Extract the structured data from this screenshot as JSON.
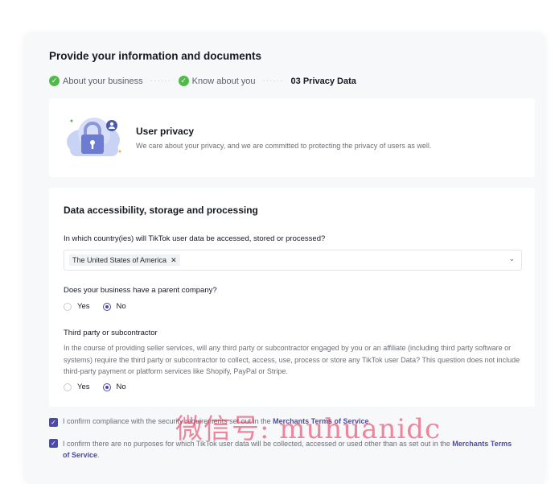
{
  "page": {
    "title": "Provide your information and documents",
    "steps": [
      {
        "label": "About your business",
        "done": true
      },
      {
        "label": "Know about you",
        "done": true
      },
      {
        "label": "03 Privacy Data",
        "done": false
      }
    ]
  },
  "privacy_card": {
    "title": "User privacy",
    "description": "We care about your privacy, and we are committed to protecting the privacy of users as well."
  },
  "data_section": {
    "title": "Data accessibility, storage and processing",
    "country_question": "In which country(ies) will TikTok user data be accessed, stored or processed?",
    "selected_country": "The United States of America",
    "parent_question": "Does your business have a parent company?",
    "parent_options": {
      "yes": "Yes",
      "no": "No",
      "selected": "No"
    },
    "third_party_title": "Third party or subcontractor",
    "third_party_text": "In the course of providing seller services, will any third party or subcontractor engaged by you or an affiliate (including third party software or systems) require the third party or subcontractor to collect, access, use, process or store any TikTok user Data? This question does not include third-party payment or platform services like Shopify, PayPal or Stripe.",
    "third_party_options": {
      "yes": "Yes",
      "no": "No",
      "selected": "No"
    }
  },
  "confirmations": {
    "c1_prefix": "I confirm compliance with the security requirements set out in the ",
    "c1_link": "Merchants Terms of Service",
    "c1_suffix": ".",
    "c2_prefix": "I confirm there are no purposes for which TikTok user data will be collected, accessed or used other than as set out in the ",
    "c2_link": "Merchants Terms of Service",
    "c2_suffix": "."
  },
  "watermark": "微信号: muhuanidc",
  "colors": {
    "accent": "#4b4aa9",
    "success": "#52b94a"
  }
}
